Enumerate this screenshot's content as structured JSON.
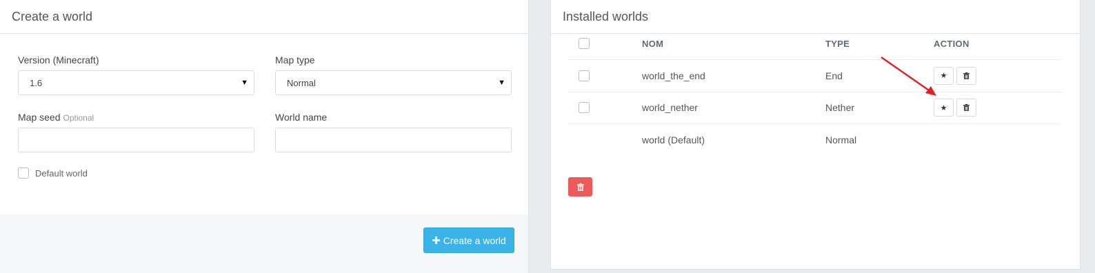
{
  "create_panel": {
    "title": "Create a world",
    "version_label": "Version (Minecraft)",
    "version_value": "1.6",
    "map_type_label": "Map type",
    "map_type_value": "Normal",
    "map_seed_label": "Map seed",
    "map_seed_optional": "Optional",
    "map_seed_value": "",
    "world_name_label": "World name",
    "world_name_value": "",
    "default_world_label": "Default world",
    "create_button_label": "Create a world"
  },
  "installed_panel": {
    "title": "Installed worlds",
    "columns": [
      "NOM",
      "TYPE",
      "ACTION"
    ],
    "rows": [
      {
        "name": "world_the_end",
        "type": "End"
      },
      {
        "name": "world_nether",
        "type": "Nether"
      },
      {
        "name": "world (Default)",
        "type": "Normal"
      }
    ]
  },
  "colors": {
    "create_button": "#3ab4e8",
    "delete_button": "#ec5a5a",
    "annotation_arrow": "#e41e1e"
  },
  "icons": {
    "plus": "plus-icon",
    "star": "star-icon",
    "trash": "trash-icon",
    "caret": "caret-down-icon"
  }
}
